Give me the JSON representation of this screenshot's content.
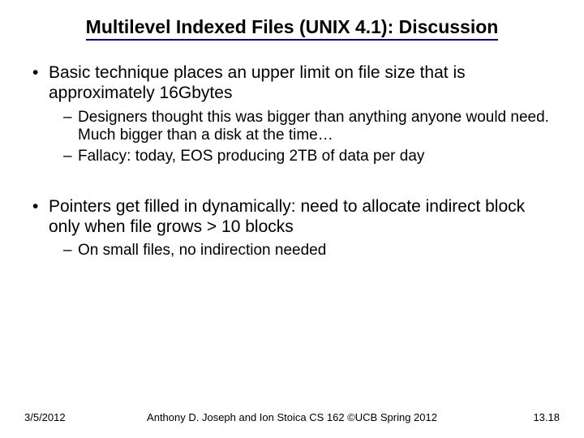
{
  "title": "Multilevel Indexed Files (UNIX 4.1): Discussion",
  "bullets": {
    "b1": "Basic technique places an upper limit on file size that is approximately 16Gbytes",
    "b1s1": "Designers thought this was bigger than anything anyone would need.  Much bigger than a disk at the time…",
    "b1s2": "Fallacy: today, EOS producing 2TB of data per day",
    "b2": "Pointers get filled in dynamically: need to allocate indirect block only when file grows > 10 blocks",
    "b2s1": "On small files, no indirection needed"
  },
  "footer": {
    "date": "3/5/2012",
    "center": "Anthony D. Joseph and Ion Stoica CS 162 ©UCB Spring 2012",
    "pagenum": "13.18"
  }
}
